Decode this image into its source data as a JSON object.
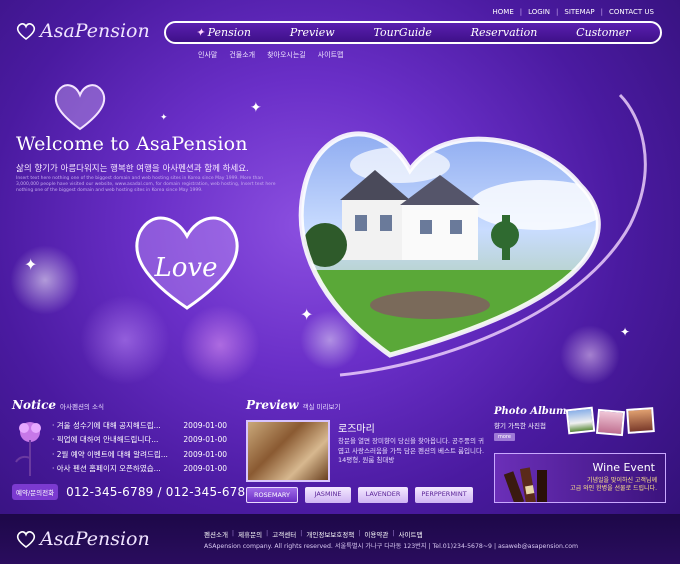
{
  "brand": {
    "logo_text": "AsaPension"
  },
  "top_links": [
    "HOME",
    "LOGIN",
    "SITEMAP",
    "CONTACT US"
  ],
  "main_nav": [
    "Pension",
    "Preview",
    "TourGuide",
    "Reservation",
    "Customer"
  ],
  "sub_nav": [
    "인사말",
    "건물소개",
    "찾아오시는길",
    "사이트맵"
  ],
  "hero": {
    "welcome": "Welcome to AsaPension",
    "tagline": "삶의 향기가 아름다워지는 행복한 여행을 아사펜션과 함께 하세요.",
    "small_text": "Insert text here nothing one of the biggest domain and web hosting sites in Korea since May 1999. More than 3,000,000 people have visited our website, www.asadal.com, for domain registration, web hosting, Insert text here nothing one of the biggest domain and web hosting sites in Korea since May 1999.",
    "love_text": "Love"
  },
  "notice": {
    "title": "Notice",
    "subtitle": "아사펜션의 소식",
    "items": [
      {
        "text": "겨울 성수기에 대해 공지해드립...",
        "date": "2009-01-00"
      },
      {
        "text": "픽업에 대하여 안내해드립니다...",
        "date": "2009-01-00"
      },
      {
        "text": "2월 예약 이벤트에 대해 알려드립...",
        "date": "2009-01-00"
      },
      {
        "text": "아사 펜션 홈페이지 오픈하였습...",
        "date": "2009-01-00"
      }
    ],
    "phone_label": "예약/문의전화",
    "phone_numbers": "012-345-6789 / 012-345-6780"
  },
  "preview": {
    "title": "Preview",
    "subtitle": "객실 미리보기",
    "room_title": "로즈마리",
    "room_desc": "창문을 열면 장미향이 당신을 찾아옵니다. 공주풍의 귀엽고 사랑스러움을 가득 담은 펜션의 베스트 룸입니다. 14평형, 원룸 침대방",
    "tabs": [
      "ROSEMARY",
      "JASMINE",
      "LAVENDER",
      "PERPPERMINT"
    ],
    "active_tab": "ROSEMARY"
  },
  "album": {
    "title": "Photo Album",
    "subtitle": "향기 가득한 사진첩",
    "more": "more"
  },
  "wine": {
    "title": "Wine Event",
    "line1": "기념일을 맞이하신 고객님께",
    "line2": "고급 와인 한병을 선물로 드립니다."
  },
  "footer": {
    "links": [
      "펜션소개",
      "제휴문의",
      "고객센터",
      "개인정보보호정책",
      "이용약관",
      "사이트맵"
    ],
    "copyright": "ASApension company. All rights reserved.   서울특별시 가나구 다라동 123번지  |  Tel.01)234-5678~9  |  asaweb@asapension.com"
  },
  "colors": {
    "accent": "#6a2fc8",
    "footer": "#1d0848",
    "highlight": "#ffe68a"
  }
}
